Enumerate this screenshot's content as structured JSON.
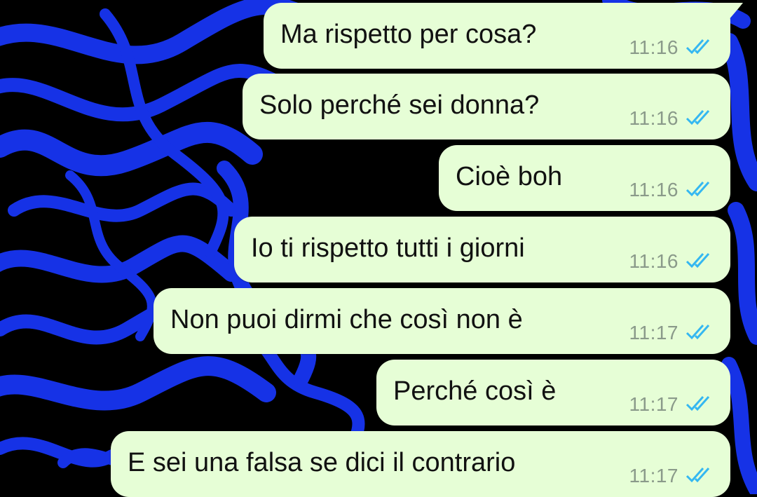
{
  "chat": {
    "bubble_color": "#e6fed6",
    "tick_color": "#34b7f1",
    "wallpaper_colors": [
      "#000000",
      "#1632e6"
    ],
    "messages": [
      {
        "text": "Ma rispetto per cosa?",
        "time": "11:16",
        "status": "read",
        "icon": "double-check-icon"
      },
      {
        "text": "Solo perché sei donna?",
        "time": "11:16",
        "status": "read",
        "icon": "double-check-icon"
      },
      {
        "text": "Cioè boh",
        "time": "11:16",
        "status": "read",
        "icon": "double-check-icon"
      },
      {
        "text": "Io ti rispetto tutti i giorni",
        "time": "11:16",
        "status": "read",
        "icon": "double-check-icon"
      },
      {
        "text": "Non puoi dirmi che così non è",
        "time": "11:17",
        "status": "read",
        "icon": "double-check-icon"
      },
      {
        "text": "Perché così è",
        "time": "11:17",
        "status": "read",
        "icon": "double-check-icon"
      },
      {
        "text": "E sei una falsa se dici il contrario",
        "time": "11:17",
        "status": "read",
        "icon": "double-check-icon"
      }
    ]
  }
}
